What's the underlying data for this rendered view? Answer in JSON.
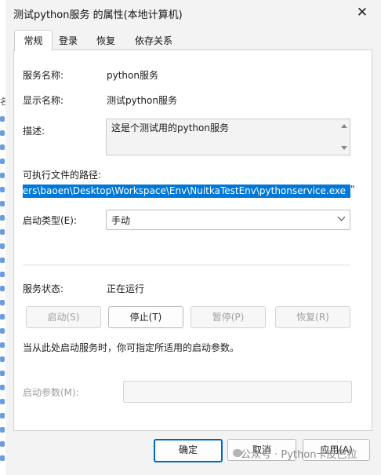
{
  "window": {
    "title": "测试python服务 的属性(本地计算机)",
    "close_glyph": "✕"
  },
  "tabs": [
    {
      "label": "常规"
    },
    {
      "label": "登录"
    },
    {
      "label": "恢复"
    },
    {
      "label": "依存关系"
    }
  ],
  "general": {
    "service_name_label": "服务名称:",
    "service_name": "python服务",
    "display_name_label": "显示名称:",
    "display_name": "测试python服务",
    "description_label": "描述:",
    "description": "这是个测试用的python服务",
    "path_label": "可执行文件的路径:",
    "path": "C:\\Users\\baoen\\Desktop\\Workspace\\Env\\NuitkaTestEnv\\pythonservice.exe",
    "path_tail": "\"",
    "startup_type_label": "启动类型(E):",
    "startup_type": "手动",
    "status_label": "服务状态:",
    "status": "正在运行",
    "start_label": "启动(S)",
    "stop_label": "停止(T)",
    "pause_label": "暂停(P)",
    "resume_label": "恢复(R)",
    "hint": "当从此处启动服务时，你可指定所适用的启动参数。",
    "params_label": "启动参数(M):",
    "params_value": ""
  },
  "footer": {
    "ok_label": "确定",
    "cancel_label": "取消",
    "apply_label": "应用(A)"
  },
  "watermark": "公众号 · Python卡皮巴拉",
  "background_strip_char": "名",
  "colors": {
    "selection": "#0078d7",
    "primary_border": "#0067c0"
  }
}
